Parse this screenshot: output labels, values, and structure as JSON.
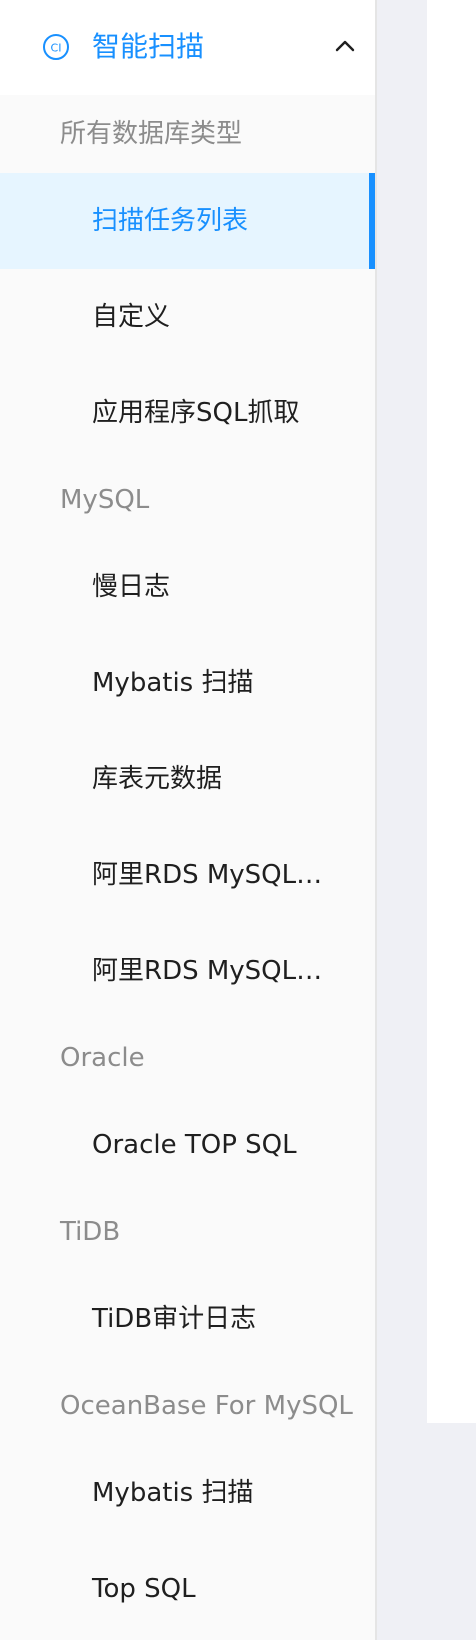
{
  "sidebar": {
    "header": {
      "icon": "ci-circle-icon",
      "title": "智能扫描",
      "toggle_icon": "chevron-up-icon",
      "accent_color": "#1890ff"
    },
    "groups": [
      {
        "title": "所有数据库类型",
        "items": [
          {
            "label": "扫描任务列表",
            "active": true
          },
          {
            "label": "自定义"
          },
          {
            "label": "应用程序SQL抓取"
          }
        ]
      },
      {
        "title": "MySQL",
        "items": [
          {
            "label": "慢日志"
          },
          {
            "label": "Mybatis 扫描"
          },
          {
            "label": "库表元数据"
          },
          {
            "label": "阿里RDS MySQL慢..."
          },
          {
            "label": "阿里RDS MySQL审..."
          }
        ]
      },
      {
        "title": "Oracle",
        "items": [
          {
            "label": "Oracle TOP SQL"
          }
        ]
      },
      {
        "title": "TiDB",
        "items": [
          {
            "label": "TiDB审计日志"
          }
        ]
      },
      {
        "title": "OceanBase For MySQL",
        "items": [
          {
            "label": "Mybatis 扫描"
          },
          {
            "label": "Top SQL"
          }
        ]
      }
    ]
  }
}
